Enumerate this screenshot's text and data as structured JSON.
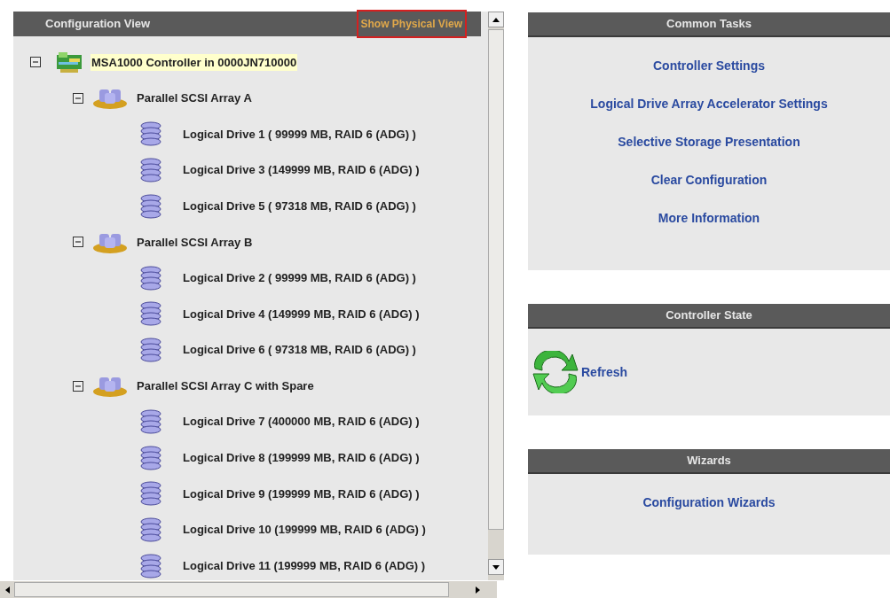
{
  "configuration_view": {
    "title": "Configuration View",
    "link": "Show Physical View",
    "tree": [
      {
        "kind": "controller",
        "label": "MSA1000 Controller in 0000JN710000",
        "selected": true,
        "expanded": true,
        "children": [
          {
            "kind": "array",
            "label": "Parallel SCSI Array A",
            "selected": false,
            "expanded": true,
            "children": [
              {
                "kind": "drive",
                "label": "Logical Drive 1 ( 99999 MB, RAID 6 (ADG) )",
                "selected": false
              },
              {
                "kind": "drive",
                "label": "Logical Drive 3 (149999 MB, RAID 6 (ADG) )",
                "selected": false
              },
              {
                "kind": "drive",
                "label": "Logical Drive 5 ( 97318 MB, RAID 6 (ADG) )",
                "selected": false
              }
            ]
          },
          {
            "kind": "array",
            "label": "Parallel SCSI Array B",
            "selected": false,
            "expanded": true,
            "children": [
              {
                "kind": "drive",
                "label": "Logical Drive 2 ( 99999 MB, RAID 6 (ADG) )",
                "selected": false
              },
              {
                "kind": "drive",
                "label": "Logical Drive 4 (149999 MB, RAID 6 (ADG) )",
                "selected": false
              },
              {
                "kind": "drive",
                "label": "Logical Drive 6 ( 97318 MB, RAID 6 (ADG) )",
                "selected": false
              }
            ]
          },
          {
            "kind": "array",
            "label": "Parallel SCSI Array C with Spare",
            "selected": false,
            "expanded": true,
            "children": [
              {
                "kind": "drive",
                "label": "Logical Drive 7 (400000 MB, RAID 6 (ADG) )",
                "selected": false
              },
              {
                "kind": "drive",
                "label": "Logical Drive 8 (199999 MB, RAID 6 (ADG) )",
                "selected": false
              },
              {
                "kind": "drive",
                "label": "Logical Drive 9 (199999 MB, RAID 6 (ADG) )",
                "selected": false
              },
              {
                "kind": "drive",
                "label": "Logical Drive 10 (199999 MB, RAID 6 (ADG) )",
                "selected": false
              },
              {
                "kind": "drive",
                "label": "Logical Drive 11 (199999 MB, RAID 6 (ADG) )",
                "selected": false
              }
            ]
          }
        ]
      }
    ]
  },
  "panels": [
    {
      "kind": "links",
      "title": "Common Tasks",
      "links": [
        "Controller Settings",
        "Logical Drive Array Accelerator Settings",
        "Selective Storage Presentation",
        "Clear Configuration",
        "More Information"
      ]
    },
    {
      "kind": "refresh",
      "title": "Controller State",
      "links": [
        "Refresh"
      ]
    },
    {
      "kind": "links",
      "title": "Wizards",
      "links": [
        "Configuration Wizards"
      ]
    }
  ]
}
